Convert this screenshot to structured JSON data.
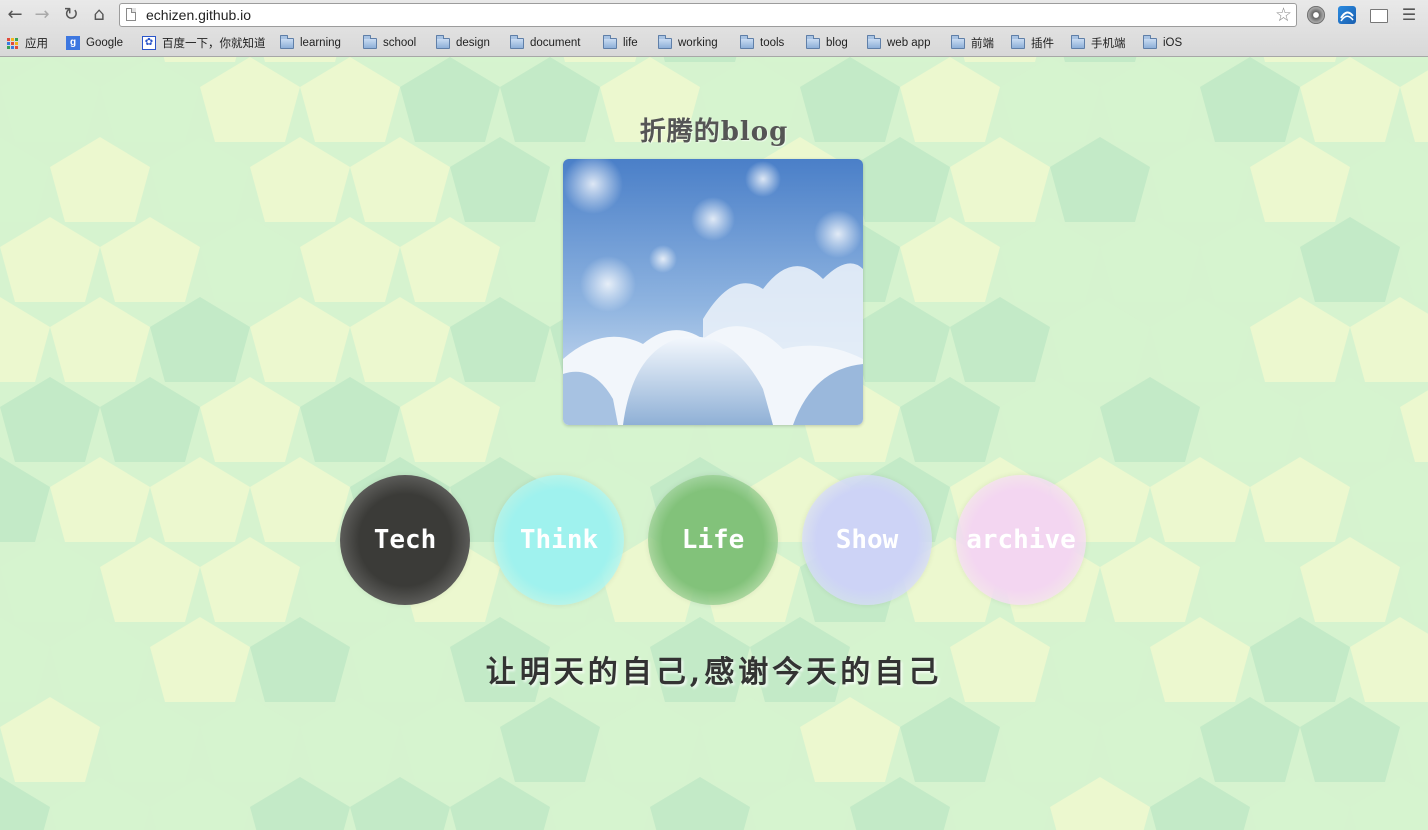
{
  "browser": {
    "url": "echizen.github.io",
    "bookmarks": [
      {
        "label": "应用",
        "icon": "apps-icon"
      },
      {
        "label": "Google",
        "icon": "google-icon"
      },
      {
        "label": "百度一下，你就知道",
        "icon": "baidu-icon"
      },
      {
        "label": "learning",
        "icon": "folder-icon"
      },
      {
        "label": "school",
        "icon": "folder-icon"
      },
      {
        "label": "design",
        "icon": "folder-icon"
      },
      {
        "label": "document",
        "icon": "folder-icon"
      },
      {
        "label": "life",
        "icon": "folder-icon"
      },
      {
        "label": "working",
        "icon": "folder-icon"
      },
      {
        "label": "tools",
        "icon": "folder-icon"
      },
      {
        "label": "blog",
        "icon": "folder-icon"
      },
      {
        "label": "web app",
        "icon": "folder-icon"
      },
      {
        "label": "前端",
        "icon": "folder-icon"
      },
      {
        "label": "插件",
        "icon": "folder-icon"
      },
      {
        "label": "手机端",
        "icon": "folder-icon"
      },
      {
        "label": "iOS",
        "icon": "folder-icon"
      }
    ]
  },
  "page": {
    "title": "折腾的blog",
    "motto": "让明天的自己,感谢今天的自己",
    "nav": [
      {
        "label": "Tech",
        "color": "#3b3b38"
      },
      {
        "label": "Think",
        "color": "#9ff2ee"
      },
      {
        "label": "Life",
        "color": "#82c27a"
      },
      {
        "label": "Show",
        "color": "#cdd3f6"
      },
      {
        "label": "archive",
        "color": "#f3d6f1"
      }
    ]
  },
  "colors": {
    "bg_light": "#f0f8cf",
    "bg_mid": "#d6f3cf",
    "bg_dark": "#bfe8c5"
  }
}
